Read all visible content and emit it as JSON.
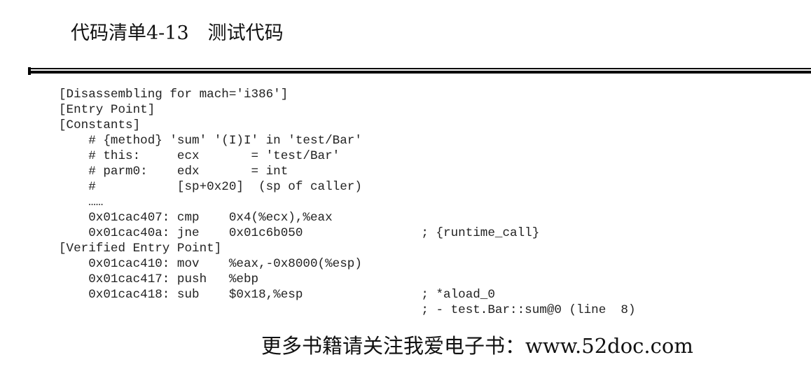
{
  "listing": {
    "title": "代码清单4-13　测试代码"
  },
  "code": {
    "lines": [
      "[Disassembling for mach='i386']",
      "[Entry Point]",
      "[Constants]",
      "    # {method} 'sum' '(I)I' in 'test/Bar'",
      "    # this:     ecx       = 'test/Bar'",
      "    # parm0:    edx       = int",
      "    #           [sp+0x20]  (sp of caller)",
      "    ……",
      "    0x01cac407: cmp    0x4(%ecx),%eax",
      "    0x01cac40a: jne    0x01c6b050                ; {runtime_call}",
      "[Verified Entry Point]",
      "    0x01cac410: mov    %eax,-0x8000(%esp)",
      "    0x01cac417: push   %ebp",
      "    0x01cac418: sub    $0x18,%esp                ; *aload_0",
      "                                                 ; - test.Bar::sum@0 (line  8)"
    ]
  },
  "footer": {
    "text": "更多书籍请关注我爱电子书：www.52doc.com"
  }
}
